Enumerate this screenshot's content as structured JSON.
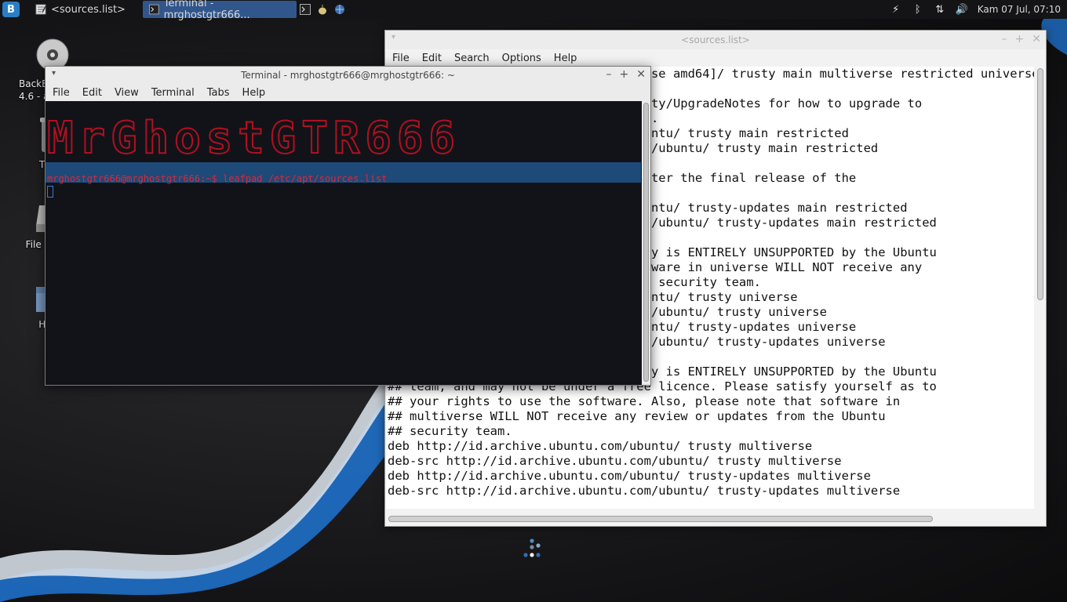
{
  "panel": {
    "tasks": [
      {
        "label": "<sources.list>",
        "icon": "text-editor-icon",
        "active": false
      },
      {
        "label": "Terminal - mrghostgtr666...",
        "icon": "terminal-icon",
        "active": true
      }
    ],
    "launchers": [
      "terminal-launcher-icon",
      "onion-icon",
      "browser-icon"
    ],
    "clock": "Kam 07 Jul, 07:10"
  },
  "desktop": {
    "icons": [
      {
        "label": "BackBox\n4.6 - amd64",
        "icon": "cd-icon",
        "visible_label": "BackB\n4.6 - a"
      },
      {
        "label": "T",
        "icon": "trash-icon"
      },
      {
        "label": "File System",
        "icon": "drive-icon"
      },
      {
        "label": "Home",
        "icon": "home-folder-icon"
      }
    ]
  },
  "leafpad": {
    "title": "<sources.list>",
    "menu": [
      "File",
      "Edit",
      "Search",
      "Options",
      "Help"
    ],
    "lines": [
      "deb cdrom:[BackBox Linux 4.6 - Release amd64]/ trusty main multiverse restricted universe",
      "",
      "# See http://help.ubuntu.com/community/UpgradeNotes for how to upgrade to",
      "# newer versions of the distribution.",
      "deb http://id.archive.ubuntu.com/ubuntu/ trusty main restricted",
      "deb-src http://id.archive.ubuntu.com/ubuntu/ trusty main restricted",
      "",
      "## Major bug fix updates produced after the final release of the",
      "## distribution.",
      "deb http://id.archive.ubuntu.com/ubuntu/ trusty-updates main restricted",
      "deb-src http://id.archive.ubuntu.com/ubuntu/ trusty-updates main restricted",
      "",
      "## N.B. software from this repository is ENTIRELY UNSUPPORTED by the Ubuntu",
      "## team. Also, please note that software in universe WILL NOT receive any",
      "## review or updates from the Ubuntu security team.",
      "deb http://id.archive.ubuntu.com/ubuntu/ trusty universe",
      "deb-src http://id.archive.ubuntu.com/ubuntu/ trusty universe",
      "deb http://id.archive.ubuntu.com/ubuntu/ trusty-updates universe",
      "deb-src http://id.archive.ubuntu.com/ubuntu/ trusty-updates universe",
      "",
      "## N.B. software from this repository is ENTIRELY UNSUPPORTED by the Ubuntu",
      "## team, and may not be under a free licence. Please satisfy yourself as to",
      "## your rights to use the software. Also, please note that software in",
      "## multiverse WILL NOT receive any review or updates from the Ubuntu",
      "## security team.",
      "deb http://id.archive.ubuntu.com/ubuntu/ trusty multiverse",
      "deb-src http://id.archive.ubuntu.com/ubuntu/ trusty multiverse",
      "deb http://id.archive.ubuntu.com/ubuntu/ trusty-updates multiverse",
      "deb-src http://id.archive.ubuntu.com/ubuntu/ trusty-updates multiverse"
    ]
  },
  "terminal": {
    "title": "Terminal - mrghostgtr666@mrghostgtr666: ~",
    "menu": [
      "File",
      "Edit",
      "View",
      "Terminal",
      "Tabs",
      "Help"
    ],
    "banner": "MrGhostGTR666",
    "prompt": "mrghostgtr666@mrghostgtr666:~$ leafpad /etc/apt/sources.list"
  },
  "colors": {
    "panel_bg": "#141416",
    "task_active": "#31568c",
    "prompt_red": "#e0263a",
    "prompt_bar": "#1d4a78",
    "banner_red": "#b01020"
  }
}
